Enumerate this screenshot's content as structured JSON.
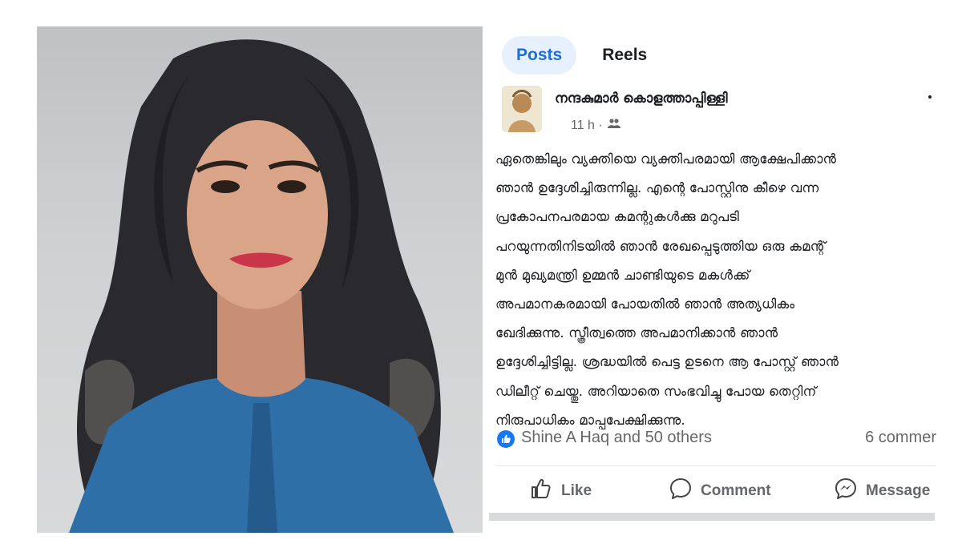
{
  "tabs": [
    {
      "label": "Posts",
      "active": true
    },
    {
      "label": "Reels",
      "active": false
    }
  ],
  "post": {
    "author": "നന്ദകുമാർ കൊളത്താപ്പിള്ളി",
    "time": "11 h ·",
    "audience_icon": "friends-icon",
    "body": "ഏതെങ്കിലും വ്യക്തിയെ വ്യക്തിപരമായി ആക്ഷേപിക്കാൻ\nഞാൻ ഉദ്ദേശിച്ചിരുന്നില്ല. എന്റെ പോസ്റ്റിനു കീഴെ വന്ന\nപ്രകോപനപരമായ കമന്റുകൾക്കു മറുപടി\nപറയുന്നതിനിടയിൽ ഞാൻ രേഖപ്പെടുത്തിയ ഒരു കമന്റ്\nമുൻ മുഖ്യമന്ത്രി ഉമ്മൻ ചാണ്ടിയുടെ മകൾക്ക്\nഅപമാനകരമായി പോയതിൽ ഞാൻ അത്യധികം\nഖേദിക്കുന്നു. സ്ത്രീത്വത്തെ അപമാനിക്കാൻ ഞാൻ\nഉദ്ദേശിച്ചിട്ടില്ല. ശ്രദ്ധയിൽ പെട്ട ഉടനെ ആ പോസ്റ്റ് ഞാൻ\nഡിലീറ്റ് ചെയ്തു. അറിയാതെ സംഭവിച്ചു പോയ തെറ്റിന്\nനിരുപാധികം മാപ്പപേക്ഷിക്കുന്നു."
  },
  "reactions": {
    "names": "Shine A Haq and 50 others",
    "comments": "6 commer"
  },
  "actions": {
    "like": "Like",
    "comment": "Comment",
    "message": "Message"
  },
  "colors": {
    "accent": "#1a6fd8",
    "active_tab_bg": "#e7f0fd",
    "muted_text": "#65676b"
  }
}
